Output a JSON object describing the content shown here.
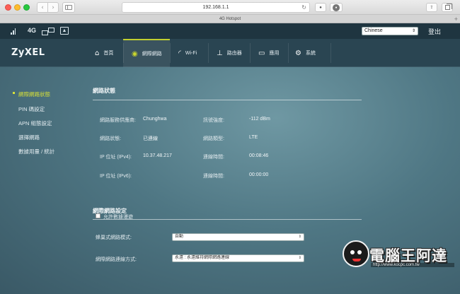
{
  "browser": {
    "url": "192.168.1.1",
    "tab_title": "4G Hotspot",
    "icons": [
      "back-icon",
      "forward-icon",
      "sidebar-icon",
      "reload-icon",
      "share-icon",
      "tabs-icon",
      "new-tab-icon"
    ]
  },
  "statusbar": {
    "network_type": "4G",
    "language": "Chinese",
    "logout_label": "登出"
  },
  "header": {
    "logo": "ZyXEL",
    "nav": [
      {
        "label": "首頁",
        "icon": "home-icon"
      },
      {
        "label": "網際網路",
        "icon": "globe-icon",
        "active": true
      },
      {
        "label": "Wi-Fi",
        "icon": "wifi-icon"
      },
      {
        "label": "路由器",
        "icon": "router-icon"
      },
      {
        "label": "應用",
        "icon": "monitor-icon"
      },
      {
        "label": "系統",
        "icon": "gear-icon"
      }
    ]
  },
  "sidebar": {
    "items": [
      {
        "label": "網際網路狀態",
        "active": true
      },
      {
        "label": "PIN 碼設定"
      },
      {
        "label": "APN 組態設定"
      },
      {
        "label": "選擇網路"
      },
      {
        "label": "數據用量 / 統計"
      }
    ]
  },
  "status_section": {
    "title": "網路狀態",
    "rows": [
      {
        "label": "網路服務供應商:",
        "value": "Chunghwa",
        "label2": "訊號強度:",
        "value2": "-112 dBm"
      },
      {
        "label": "網路狀態:",
        "value": "已連線",
        "label2": "網路類型:",
        "value2": "LTE"
      },
      {
        "label": "IP 位址 (IPv4):",
        "value": "10.37.48.217",
        "label2": "連線時間:",
        "value2": "00:08:46"
      },
      {
        "label": "IP 位址 (IPv6):",
        "value": "",
        "label2": "連線時間:",
        "value2": "00:00:00"
      }
    ]
  },
  "settings_section": {
    "title": "網際網路設定",
    "roaming_label": "允許數據漫遊",
    "roaming_checked": false,
    "mode_label": "蜂巢式網路模式:",
    "mode_value": "自動",
    "connect_label": "網際網路連線方式:",
    "connect_value": "永遠 : 永遠維持網際網路連線"
  },
  "watermark": {
    "text": "電腦王阿達",
    "url": "http://www.kocpc.com.tw"
  }
}
